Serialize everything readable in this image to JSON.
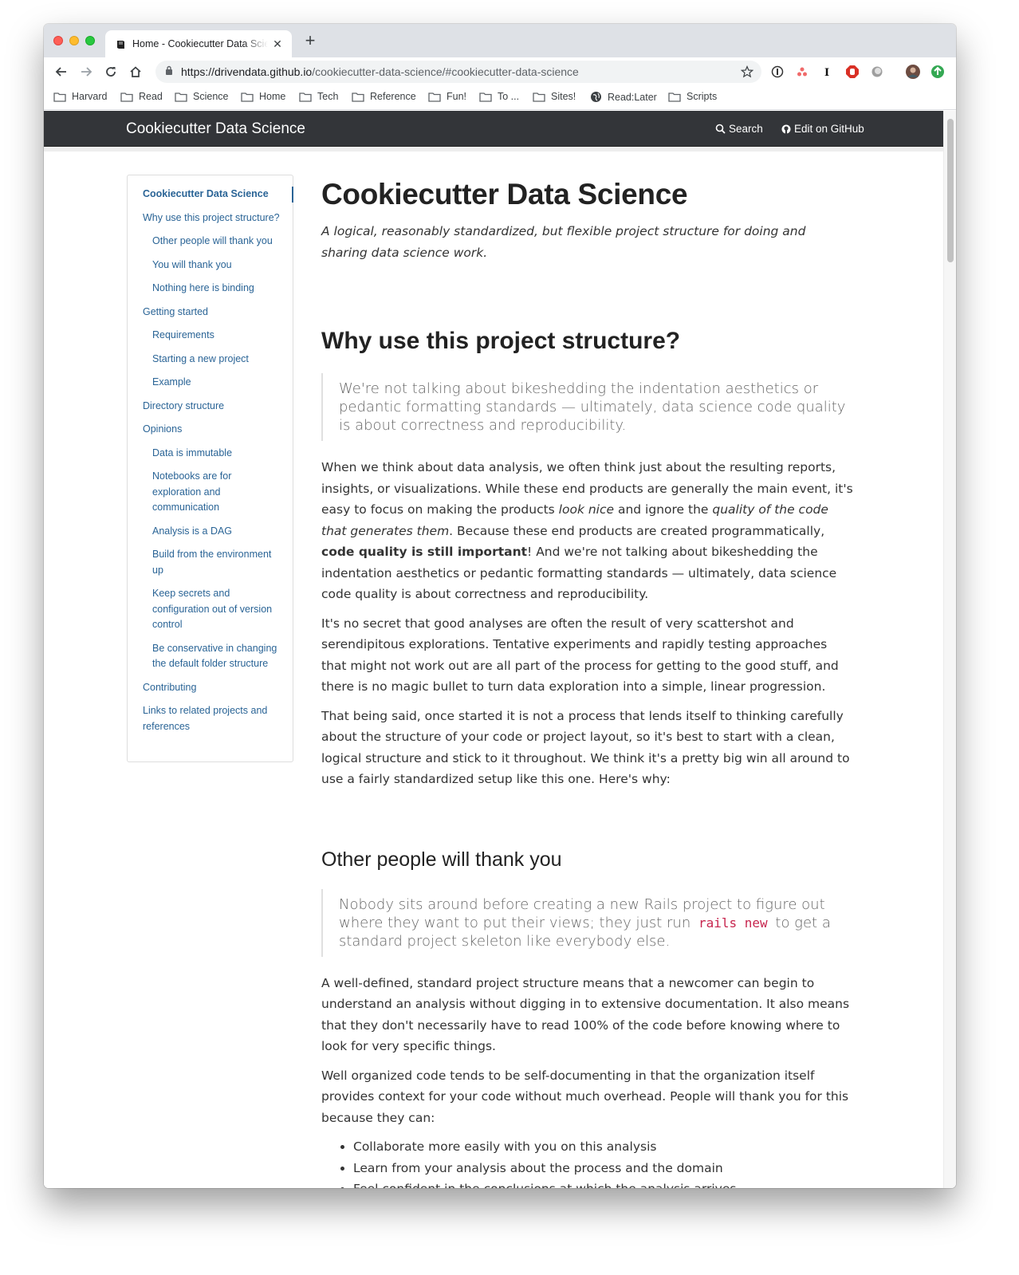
{
  "browser": {
    "tab_title": "Home - Cookiecutter Data Science",
    "new_tab_label": "+",
    "url_host": "https://drivendata.github.io",
    "url_path": "/cookiecutter-data-science/#cookiecutter-data-science",
    "bookmarks": [
      "Harvard",
      "Read",
      "Science",
      "Home",
      "Tech",
      "Reference",
      "Fun!",
      "To ...",
      "Sites!",
      "Read:Later",
      "Scripts"
    ]
  },
  "site": {
    "brand": "Cookiecutter Data Science",
    "search_label": "Search",
    "github_label": "Edit on GitHub"
  },
  "toc": [
    {
      "label": "Cookiecutter Data Science",
      "level": 1,
      "active": true
    },
    {
      "label": "Why use this project structure?",
      "level": 1
    },
    {
      "label": "Other people will thank you",
      "level": 2
    },
    {
      "label": "You will thank you",
      "level": 2
    },
    {
      "label": "Nothing here is binding",
      "level": 2
    },
    {
      "label": "Getting started",
      "level": 1
    },
    {
      "label": "Requirements",
      "level": 2
    },
    {
      "label": "Starting a new project",
      "level": 2
    },
    {
      "label": "Example",
      "level": 2
    },
    {
      "label": "Directory structure",
      "level": 1
    },
    {
      "label": "Opinions",
      "level": 1
    },
    {
      "label": "Data is immutable",
      "level": 2
    },
    {
      "label": "Notebooks are for exploration and communication",
      "level": 2
    },
    {
      "label": "Analysis is a DAG",
      "level": 2
    },
    {
      "label": "Build from the environment up",
      "level": 2
    },
    {
      "label": "Keep secrets and configuration out of version control",
      "level": 2
    },
    {
      "label": "Be conservative in changing the default folder structure",
      "level": 2
    },
    {
      "label": "Contributing",
      "level": 1
    },
    {
      "label": "Links to related projects and references",
      "level": 1
    }
  ],
  "main": {
    "title": "Cookiecutter Data Science",
    "lead": "A logical, reasonably standardized, but flexible project structure for doing and sharing data science work.",
    "why_heading": "Why use this project structure?",
    "why_quote": "We're not talking about bikeshedding the indentation aesthetics or pedantic formatting standards — ultimately, data science code quality is about correctness and reproducibility.",
    "p1_a": "When we think about data analysis, we often think just about the resulting reports, insights, or visualizations. While these end products are generally the main event, it's easy to focus on making the products ",
    "p1_em1": "look nice",
    "p1_b": " and ignore the ",
    "p1_em2": "quality of the code that generates them",
    "p1_c": ". Because these end products are created programmatically, ",
    "p1_strong": "code quality is still important",
    "p1_d": "! And we're not talking about bikeshedding the indentation aesthetics or pedantic formatting standards — ultimately, data science code quality is about correctness and reproducibility.",
    "p2": "It's no secret that good analyses are often the result of very scattershot and serendipitous explorations. Tentative experiments and rapidly testing approaches that might not work out are all part of the process for getting to the good stuff, and there is no magic bullet to turn data exploration into a simple, linear progression.",
    "p3": "That being said, once started it is not a process that lends itself to thinking carefully about the structure of your code or project layout, so it's best to start with a clean, logical structure and stick to it throughout. We think it's a pretty big win all around to use a fairly standardized setup like this one. Here's why:",
    "other_heading": "Other people will thank you",
    "other_quote_a": "Nobody sits around before creating a new Rails project to figure out where they want to put their views; they just run ",
    "other_quote_code": "rails new",
    "other_quote_b": " to get a standard project skeleton like everybody else.",
    "p4": "A well-defined, standard project structure means that a newcomer can begin to understand an analysis without digging in to extensive documentation. It also means that they don't necessarily have to read 100% of the code before knowing where to look for very specific things.",
    "p5": "Well organized code tends to be self-documenting in that the organization itself provides context for your code without much overhead. People will thank you for this because they can:",
    "bullets": [
      "Collaborate more easily with you on this analysis",
      "Learn from your analysis about the process and the domain",
      "Feel confident in the conclusions at which the analysis arrives"
    ]
  }
}
